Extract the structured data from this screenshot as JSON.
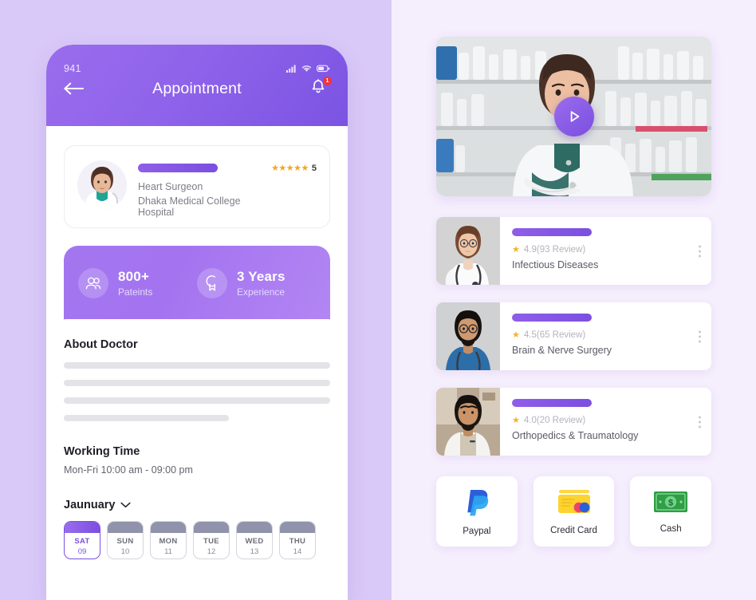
{
  "theme": {
    "left_bg": "#d9c9f8",
    "right_bg": "#f5eefd",
    "accent": "#7b4fe0",
    "accent_light": "#9a6ced",
    "star": "#f5a623",
    "badge_red": "#f0333c"
  },
  "phone": {
    "status": {
      "time": "941",
      "icons": [
        "signal-icon",
        "wifi-icon",
        "battery-icon"
      ]
    },
    "nav": {
      "back_icon": "arrow-left-icon",
      "title": "Appointment",
      "bell_icon": "bell-icon",
      "bell_badge": "1"
    },
    "doctor_card": {
      "avatar": "doctor-avatar",
      "name_placeholder": "",
      "specialty": "Heart Surgeon",
      "hospital": "Dhaka Medical College Hospital",
      "stars": "★★★★★",
      "rating": "5"
    },
    "stats": [
      {
        "icon": "patients-icon",
        "value": "800+",
        "label": "Pateints"
      },
      {
        "icon": "award-icon",
        "value": "3 Years",
        "label": "Experience"
      }
    ],
    "about": {
      "title": "About Doctor",
      "lines": [
        "",
        "",
        "",
        ""
      ]
    },
    "working": {
      "title": "Working Time",
      "value": "Mon-Fri 10:00 am - 09:00 pm"
    },
    "calendar": {
      "month": "Jaunuary",
      "chevron_icon": "chevron-down-icon",
      "days": [
        {
          "dow": "SAT",
          "num": "09",
          "active": true
        },
        {
          "dow": "SUN",
          "num": "10",
          "active": false
        },
        {
          "dow": "MON",
          "num": "11",
          "active": false
        },
        {
          "dow": "TUE",
          "num": "12",
          "active": false
        },
        {
          "dow": "WED",
          "num": "13",
          "active": false
        },
        {
          "dow": "THU",
          "num": "14",
          "active": false
        }
      ]
    }
  },
  "right": {
    "video": {
      "alt": "pharmacist-video-thumbnail",
      "play_icon": "play-icon"
    },
    "doctors": [
      {
        "thumb": "doctor-thumb-1",
        "star": "★",
        "rating_text": "4.9(93 Review)",
        "specialty": "Infectious Diseases",
        "menu_icon": "kebab-menu-icon"
      },
      {
        "thumb": "doctor-thumb-2",
        "star": "★",
        "rating_text": "4.5(65 Review)",
        "specialty": "Brain & Nerve Surgery",
        "menu_icon": "kebab-menu-icon"
      },
      {
        "thumb": "doctor-thumb-3",
        "star": "★",
        "rating_text": "4.0(20 Review)",
        "specialty": "Orthopedics & Traumatology",
        "menu_icon": "kebab-menu-icon"
      }
    ],
    "payments": [
      {
        "icon": "paypal-icon",
        "label": "Paypal"
      },
      {
        "icon": "credit-card-icon",
        "label": "Credit Card"
      },
      {
        "icon": "cash-icon",
        "label": "Cash"
      }
    ]
  }
}
